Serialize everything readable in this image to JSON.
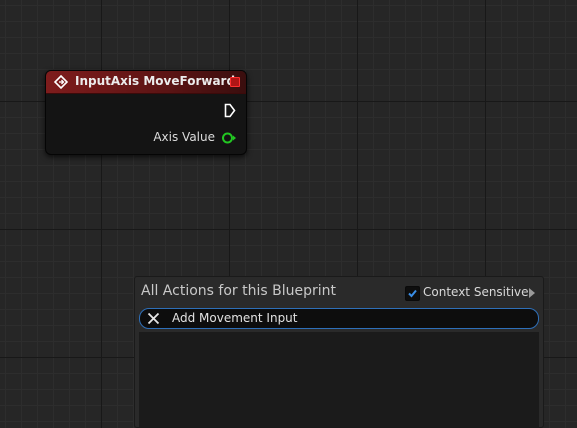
{
  "node": {
    "title": "InputAxis MoveForward",
    "output_label": "Axis Value",
    "icon": "input-event-icon",
    "header_color": "#7e1c1c",
    "pin_color": "#22c722"
  },
  "action_menu": {
    "title": "All Actions for this Blueprint",
    "context_sensitive_label": "Context Sensitive",
    "context_sensitive_checked": true,
    "search_value": "Add Movement Input",
    "accent_color": "#2e6fb8"
  }
}
